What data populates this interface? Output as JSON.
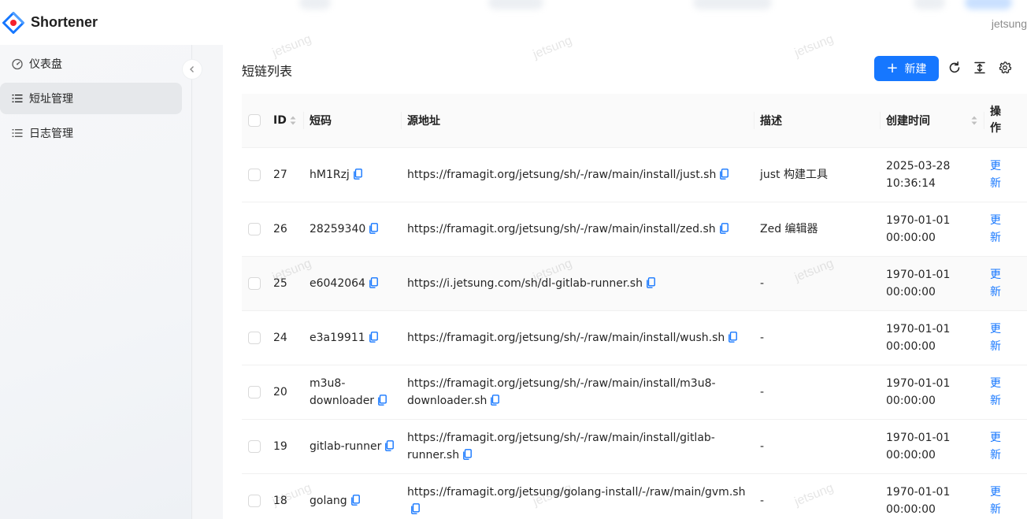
{
  "app": {
    "brand": "Shortener",
    "user": "jetsung"
  },
  "watermark": "jetsung",
  "sidebar": {
    "items": [
      {
        "label": "仪表盘",
        "icon": "dashboard-icon"
      },
      {
        "label": "短址管理",
        "icon": "list-icon",
        "active": true
      },
      {
        "label": "日志管理",
        "icon": "list-icon"
      }
    ]
  },
  "page": {
    "title": "短链列表",
    "new_label": "新建"
  },
  "table": {
    "headers": {
      "id": "ID",
      "code": "短码",
      "source": "源地址",
      "desc": "描述",
      "created": "创建时间",
      "ops_line1": "操",
      "ops_line2": "作"
    },
    "rows": [
      {
        "id": "27",
        "code": "hM1Rzj",
        "code2": "",
        "url": "https://framagit.org/jetsung/sh/-/raw/main/install/just.sh",
        "desc": "just 构建工具",
        "date": "2025-03-28",
        "time": "10:36:14",
        "op1": "更",
        "op2": "新"
      },
      {
        "id": "26",
        "code": "28259340",
        "code2": "",
        "url": "https://framagit.org/jetsung/sh/-/raw/main/install/zed.sh",
        "desc": "Zed 编辑器",
        "date": "1970-01-01",
        "time": "00:00:00",
        "op1": "更",
        "op2": "新"
      },
      {
        "id": "25",
        "code": "e6042064",
        "code2": "",
        "url": "https://i.jetsung.com/sh/dl-gitlab-runner.sh",
        "desc": "-",
        "date": "1970-01-01",
        "time": "00:00:00",
        "op1": "更",
        "op2": "新"
      },
      {
        "id": "24",
        "code": "e3a19911",
        "code2": "",
        "url": "https://framagit.org/jetsung/sh/-/raw/main/install/wush.sh",
        "desc": "-",
        "date": "1970-01-01",
        "time": "00:00:00",
        "op1": "更",
        "op2": "新"
      },
      {
        "id": "20",
        "code": "m3u8-",
        "code2": "downloader",
        "url": "https://framagit.org/jetsung/sh/-/raw/main/install/m3u8-downloader.sh",
        "desc": "-",
        "date": "1970-01-01",
        "time": "00:00:00",
        "op1": "更",
        "op2": "新"
      },
      {
        "id": "19",
        "code": "gitlab-runner",
        "code2": "",
        "url": "https://framagit.org/jetsung/sh/-/raw/main/install/gitlab-runner.sh",
        "desc": "-",
        "date": "1970-01-01",
        "time": "00:00:00",
        "op1": "更",
        "op2": "新"
      },
      {
        "id": "18",
        "code": "golang",
        "code2": "",
        "url": "https://framagit.org/jetsung/golang-install/-/raw/main/gvm.sh",
        "desc": "-",
        "date": "1970-01-01",
        "time": "00:00:00",
        "op1": "更",
        "op2": "新"
      }
    ]
  },
  "colors": {
    "primary": "#1677ff",
    "row_highlight": "#fafafa",
    "sidebar_active": "#e6e8eb"
  }
}
